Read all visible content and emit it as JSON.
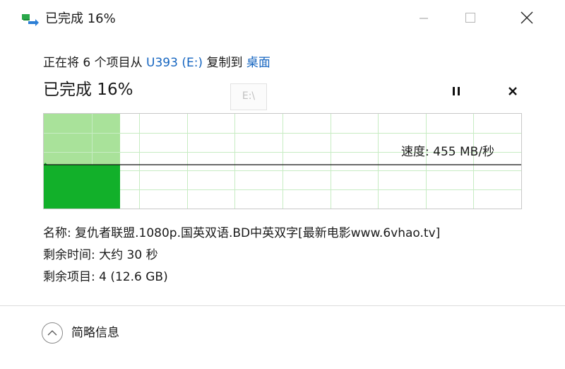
{
  "window": {
    "title": "已完成 16%"
  },
  "copy": {
    "prefix": "正在将 6 个项目从 ",
    "source": "U393 (E:)",
    "middle": " 复制到 ",
    "destination": "桌面"
  },
  "progress": {
    "title": "已完成 16%",
    "percent": 16,
    "drive_hint": "E:\\"
  },
  "speed": {
    "label": "速度: 455 MB/秒"
  },
  "details": {
    "name": "名称: 复仇者联盟.1080p.国英双语.BD中英双字[最新电影www.6vhao.tv]",
    "time_remaining": "剩余时间: 大约 30 秒",
    "items_remaining": "剩余项目: 4 (12.6 GB)"
  },
  "footer": {
    "toggle_label": "简略信息"
  },
  "colors": {
    "progress_light": "#a9e29a",
    "progress_dark": "#12b02a",
    "grid": "#c7ecc3",
    "link": "#1565c0",
    "icon_green": "#2aa84a",
    "icon_blue": "#2d7fd6"
  }
}
